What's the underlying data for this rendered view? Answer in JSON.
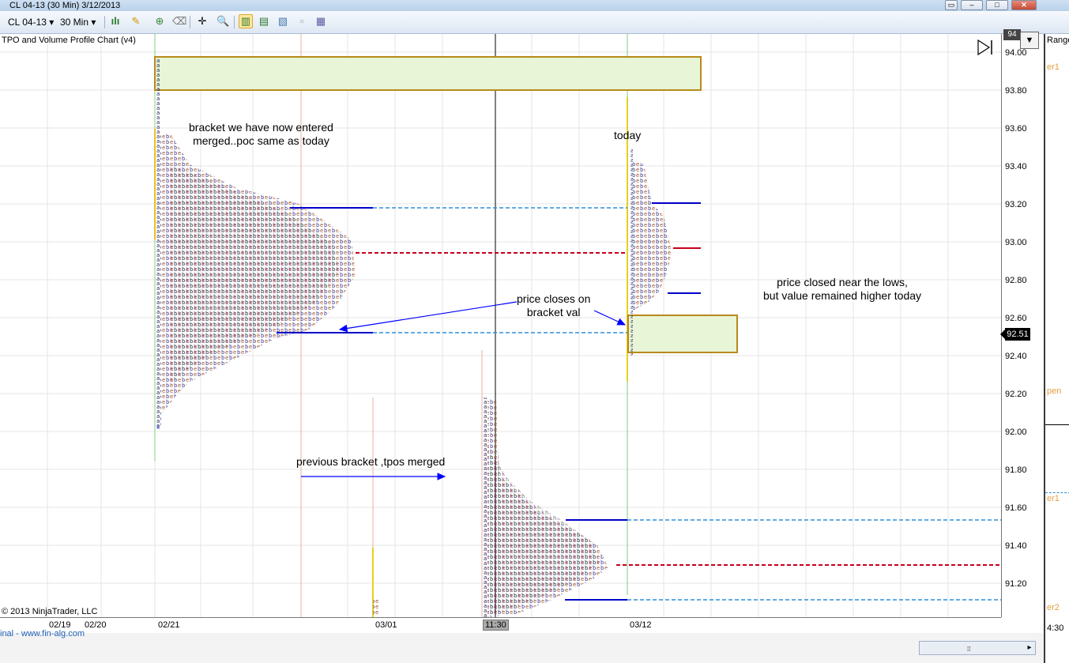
{
  "window": {
    "title": "CL 04-13 (30 Min)  3/12/2013",
    "buttons": {
      "restore": "▭",
      "minimize": "–",
      "maximize": "□",
      "close": "✕"
    }
  },
  "toolbar": {
    "instrument": "CL 04-13",
    "interval": "30 Min",
    "icons": [
      "bar-chart-icon",
      "pencil-icon",
      "plus-icon",
      "crosshair-icon",
      "zoom-icon",
      "indicators-icon",
      "strategies-icon",
      "chart-icon",
      "properties-icon",
      "templates-icon"
    ]
  },
  "chart": {
    "indicator_label": "TPO and Volume Profile Chart (v4)",
    "copyright": "2013 NinjaTrader, LLC",
    "source_link": "inal - www.fin-alg.com",
    "annotations": {
      "bracket": [
        "bracket we have now entered",
        "merged..poc same as today"
      ],
      "today": "today",
      "price_closes": [
        "price closes on",
        "bracket val"
      ],
      "closed_near_lows": [
        "price closed near the lows,",
        "but value remained higher today"
      ],
      "previous_bracket": "previous bracket ,tpos merged"
    },
    "y_axis": {
      "ticks": [
        "94.00",
        "93.80",
        "93.60",
        "93.40",
        "93.20",
        "93.00",
        "92.80",
        "92.60",
        "92.40",
        "92.20",
        "92.00",
        "91.80",
        "91.60",
        "91.40",
        "91.20"
      ],
      "top_partial": "94",
      "last_price": "92.51"
    },
    "x_axis": {
      "ticks": [
        "02/19",
        "02/20",
        "02/21",
        "03/01",
        "03/12"
      ],
      "cursor_time": "11:30"
    },
    "colors": {
      "value_area_high_low": "#0000c8",
      "poc": "#c8001e",
      "extension": "#2f8fd8",
      "box_fill": "#e8f5d6",
      "box_border": "#b88a1a"
    }
  },
  "right_panel": {
    "labels": [
      "Range",
      "er1",
      "pen",
      "er1",
      "er2",
      "4:30"
    ]
  }
}
